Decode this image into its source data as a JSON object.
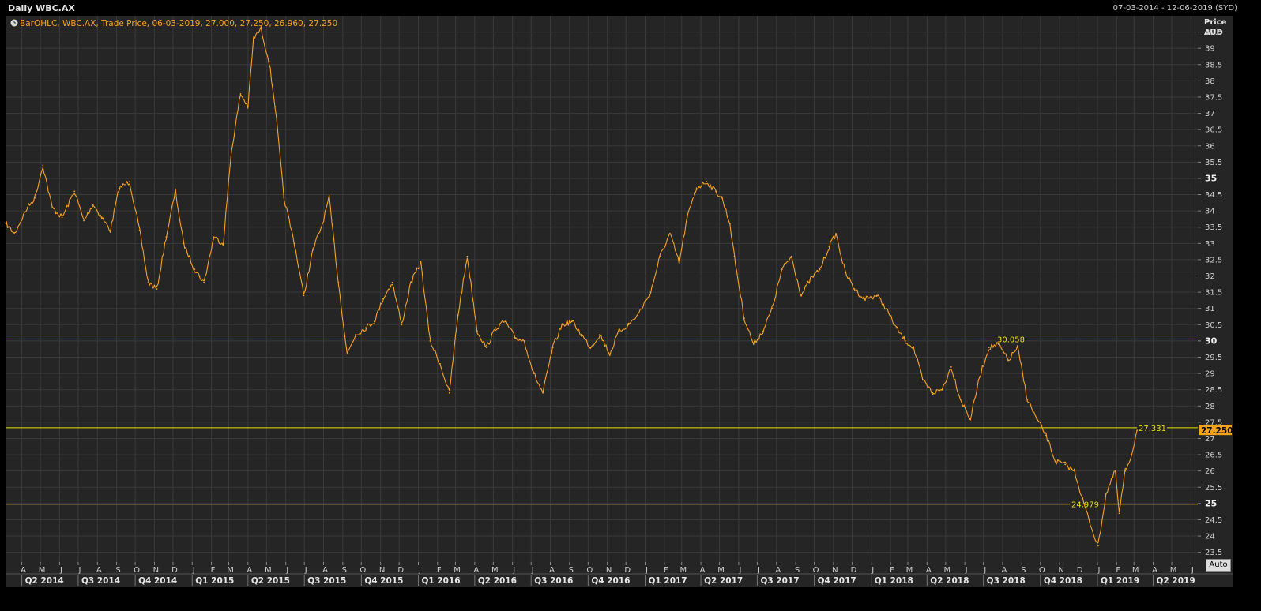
{
  "window": {
    "title": "Daily WBC.AX",
    "date_range": "07-03-2014 - 12-06-2019 (SYD)"
  },
  "legend": {
    "icon": "clock-icon",
    "text": "BarOHLC, WBC.AX, Trade Price, 06-03-2019, 27.000, 27.250, 26.960, 27.250"
  },
  "y_axis": {
    "title": "Price",
    "unit": "AUD",
    "ticks": [
      23.5,
      24,
      24.5,
      25,
      25.5,
      26,
      26.5,
      27,
      27.5,
      28,
      28.5,
      29,
      29.5,
      30,
      30.5,
      31,
      31.5,
      32,
      32.5,
      33,
      33.5,
      34,
      34.5,
      35,
      35.5,
      36,
      36.5,
      37,
      37.5,
      38,
      38.5,
      39,
      39.5
    ],
    "bold_ticks": [
      25,
      30,
      35
    ]
  },
  "current_price_label": "27.250",
  "auto_button": "Auto",
  "colors": {
    "background": "#252525",
    "grid": "#3a3a3a",
    "series": "#f7a21b",
    "hline": "#e8e000",
    "price_badge": "#f7a21b"
  },
  "chart_data": {
    "type": "line",
    "title": "Daily WBC.AX",
    "ylabel": "Price AUD",
    "ylim": [
      23.2,
      40
    ],
    "xlim": [
      "2014-03-07",
      "2019-06-12"
    ],
    "grid": true,
    "month_ticks": [
      "A",
      "M",
      "J",
      "J",
      "A",
      "S",
      "O",
      "N",
      "D",
      "J",
      "F",
      "M",
      "A",
      "M",
      "J",
      "J",
      "A",
      "S",
      "O",
      "N",
      "D",
      "J",
      "F",
      "M",
      "A",
      "M",
      "J",
      "J",
      "A",
      "S",
      "O",
      "N",
      "D",
      "J",
      "F",
      "M",
      "A",
      "M",
      "J",
      "J",
      "A",
      "S",
      "O",
      "N",
      "D",
      "J",
      "F",
      "M",
      "A",
      "M",
      "J",
      "J",
      "A",
      "S",
      "O",
      "N",
      "D",
      "J",
      "F",
      "M",
      "A",
      "M",
      "J"
    ],
    "quarter_labels": [
      "Q2 2014",
      "Q3 2014",
      "Q4 2014",
      "Q1 2015",
      "Q2 2015",
      "Q3 2015",
      "Q4 2015",
      "Q1 2016",
      "Q2 2016",
      "Q3 2016",
      "Q4 2016",
      "Q1 2017",
      "Q2 2017",
      "Q3 2017",
      "Q4 2017",
      "Q1 2018",
      "Q2 2018",
      "Q3 2018",
      "Q4 2018",
      "Q1 2019",
      "Q2 2019"
    ],
    "series": [
      {
        "style": "OHLC bars",
        "x": [
          "2014-03-07",
          "2014-03-20",
          "2014-04-10",
          "2014-04-22",
          "2014-05-05",
          "2014-05-20",
          "2014-06-05",
          "2014-06-25",
          "2014-07-10",
          "2014-07-25",
          "2014-08-08",
          "2014-08-22",
          "2014-09-05",
          "2014-09-22",
          "2014-10-08",
          "2014-10-22",
          "2014-11-05",
          "2014-11-20",
          "2014-12-05",
          "2014-12-18",
          "2015-01-05",
          "2015-01-20",
          "2015-02-05",
          "2015-02-20",
          "2015-03-05",
          "2015-03-20",
          "2015-04-01",
          "2015-04-10",
          "2015-04-22",
          "2015-05-05",
          "2015-05-15",
          "2015-05-29",
          "2015-06-15",
          "2015-06-30",
          "2015-07-15",
          "2015-07-30",
          "2015-08-10",
          "2015-08-25",
          "2015-09-08",
          "2015-09-22",
          "2015-10-08",
          "2015-10-22",
          "2015-11-05",
          "2015-11-20",
          "2015-12-05",
          "2015-12-20",
          "2016-01-05",
          "2016-01-20",
          "2016-02-05",
          "2016-02-20",
          "2016-03-05",
          "2016-03-20",
          "2016-04-05",
          "2016-04-20",
          "2016-05-05",
          "2016-05-20",
          "2016-06-05",
          "2016-06-20",
          "2016-07-05",
          "2016-07-20",
          "2016-08-05",
          "2016-08-20",
          "2016-09-05",
          "2016-09-20",
          "2016-10-05",
          "2016-10-20",
          "2016-11-05",
          "2016-11-20",
          "2016-12-05",
          "2016-12-20",
          "2017-01-10",
          "2017-01-25",
          "2017-02-10",
          "2017-02-25",
          "2017-03-10",
          "2017-03-25",
          "2017-04-10",
          "2017-04-25",
          "2017-05-05",
          "2017-05-18",
          "2017-05-25",
          "2017-06-10",
          "2017-06-25",
          "2017-07-10",
          "2017-07-25",
          "2017-08-10",
          "2017-08-25",
          "2017-09-10",
          "2017-09-25",
          "2017-10-10",
          "2017-10-25",
          "2017-11-05",
          "2017-11-20",
          "2017-12-05",
          "2017-12-20",
          "2018-01-10",
          "2018-01-25",
          "2018-02-10",
          "2018-02-25",
          "2018-03-10",
          "2018-03-25",
          "2018-04-10",
          "2018-04-25",
          "2018-05-10",
          "2018-05-25",
          "2018-06-10",
          "2018-06-25",
          "2018-07-10",
          "2018-07-25",
          "2018-08-10",
          "2018-08-25",
          "2018-09-10",
          "2018-09-25",
          "2018-10-10",
          "2018-10-25",
          "2018-11-10",
          "2018-11-25",
          "2018-12-10",
          "2018-12-20",
          "2019-01-02",
          "2019-01-15",
          "2019-01-30",
          "2019-02-05",
          "2019-02-15",
          "2019-02-25",
          "2019-03-06"
        ],
        "y": [
          33.6,
          33.3,
          34.1,
          34.4,
          35.4,
          34.1,
          33.8,
          34.6,
          33.7,
          34.2,
          33.8,
          33.4,
          34.7,
          34.9,
          33.4,
          31.8,
          31.6,
          33.2,
          34.6,
          33.0,
          32.2,
          31.8,
          33.2,
          33.0,
          35.8,
          37.6,
          37.2,
          39.3,
          39.6,
          38.6,
          37.2,
          34.4,
          33.0,
          31.4,
          32.8,
          33.6,
          34.4,
          31.8,
          29.6,
          30.2,
          30.4,
          30.6,
          31.3,
          31.8,
          30.5,
          31.8,
          32.4,
          30.0,
          29.3,
          28.4,
          30.8,
          32.6,
          30.3,
          29.8,
          30.4,
          30.6,
          30.1,
          30.0,
          29.0,
          28.4,
          29.8,
          30.5,
          30.6,
          30.2,
          29.8,
          30.2,
          29.6,
          30.3,
          30.5,
          30.8,
          31.5,
          32.6,
          33.3,
          32.4,
          33.8,
          34.7,
          34.9,
          34.6,
          34.4,
          33.6,
          32.6,
          30.7,
          29.9,
          30.3,
          31.0,
          32.2,
          32.6,
          31.4,
          31.9,
          32.2,
          32.9,
          33.3,
          32.1,
          31.6,
          31.3,
          31.4,
          31.0,
          30.4,
          30.0,
          29.8,
          28.8,
          28.4,
          28.5,
          29.2,
          28.2,
          27.6,
          28.9,
          29.8,
          29.9,
          29.4,
          29.8,
          28.2,
          27.6,
          27.1,
          26.3,
          26.2,
          26.0,
          25.0,
          24.4,
          23.7,
          25.3,
          26.0,
          24.7,
          26.0,
          26.5,
          27.25
        ]
      }
    ],
    "horizontal_lines": [
      30.058,
      27.331,
      24.979
    ],
    "horizontal_line_labels": [
      "30.058",
      "27.331",
      "24.979"
    ]
  }
}
